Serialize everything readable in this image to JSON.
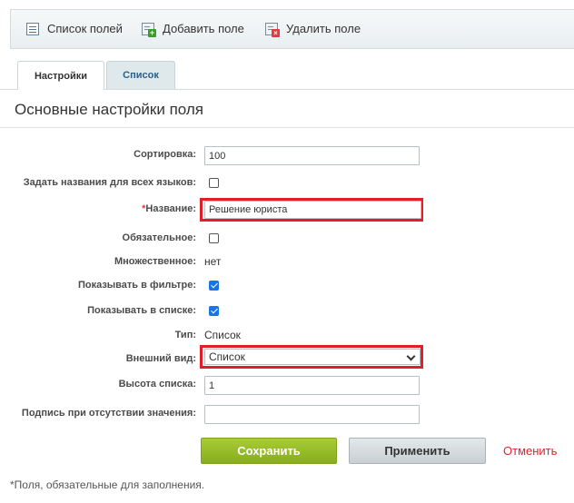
{
  "toolbar": {
    "fields_list": "Список полей",
    "add_field": "Добавить поле",
    "delete_field": "Удалить поле"
  },
  "tabs": [
    {
      "label": "Настройки",
      "active": true
    },
    {
      "label": "Список",
      "active": false
    }
  ],
  "section_title": "Основные настройки поля",
  "form": {
    "sort_label": "Сортировка:",
    "sort_value": "100",
    "all_langs_label": "Задать названия для всех языков:",
    "all_langs_checked": false,
    "name_star": "*",
    "name_label": "Название:",
    "name_value": "Решение юриста",
    "required_label": "Обязательное:",
    "required_checked": false,
    "multiple_label": "Множественное:",
    "multiple_value": "нет",
    "show_filter_label": "Показывать в фильтре:",
    "show_filter_checked": true,
    "show_list_label": "Показывать в списке:",
    "show_list_checked": true,
    "type_label": "Тип:",
    "type_value": "Список",
    "view_label": "Внешний вид:",
    "view_value": "Список",
    "list_height_label": "Высота списка:",
    "list_height_value": "1",
    "empty_caption_label": "Подпись при отсутствии значения:",
    "empty_caption_value": ""
  },
  "buttons": {
    "save": "Сохранить",
    "apply": "Применить",
    "cancel": "Отменить"
  },
  "footnote": "*Поля, обязательные для заполнения.",
  "colors": {
    "highlight": "#e31e2b",
    "save_green": "#94b826",
    "cancel_red": "#d6262b",
    "checkbox_blue": "#1a73e8"
  },
  "icons": [
    "list-icon",
    "add-field-icon",
    "delete-field-icon",
    "chevron-down-icon"
  ]
}
